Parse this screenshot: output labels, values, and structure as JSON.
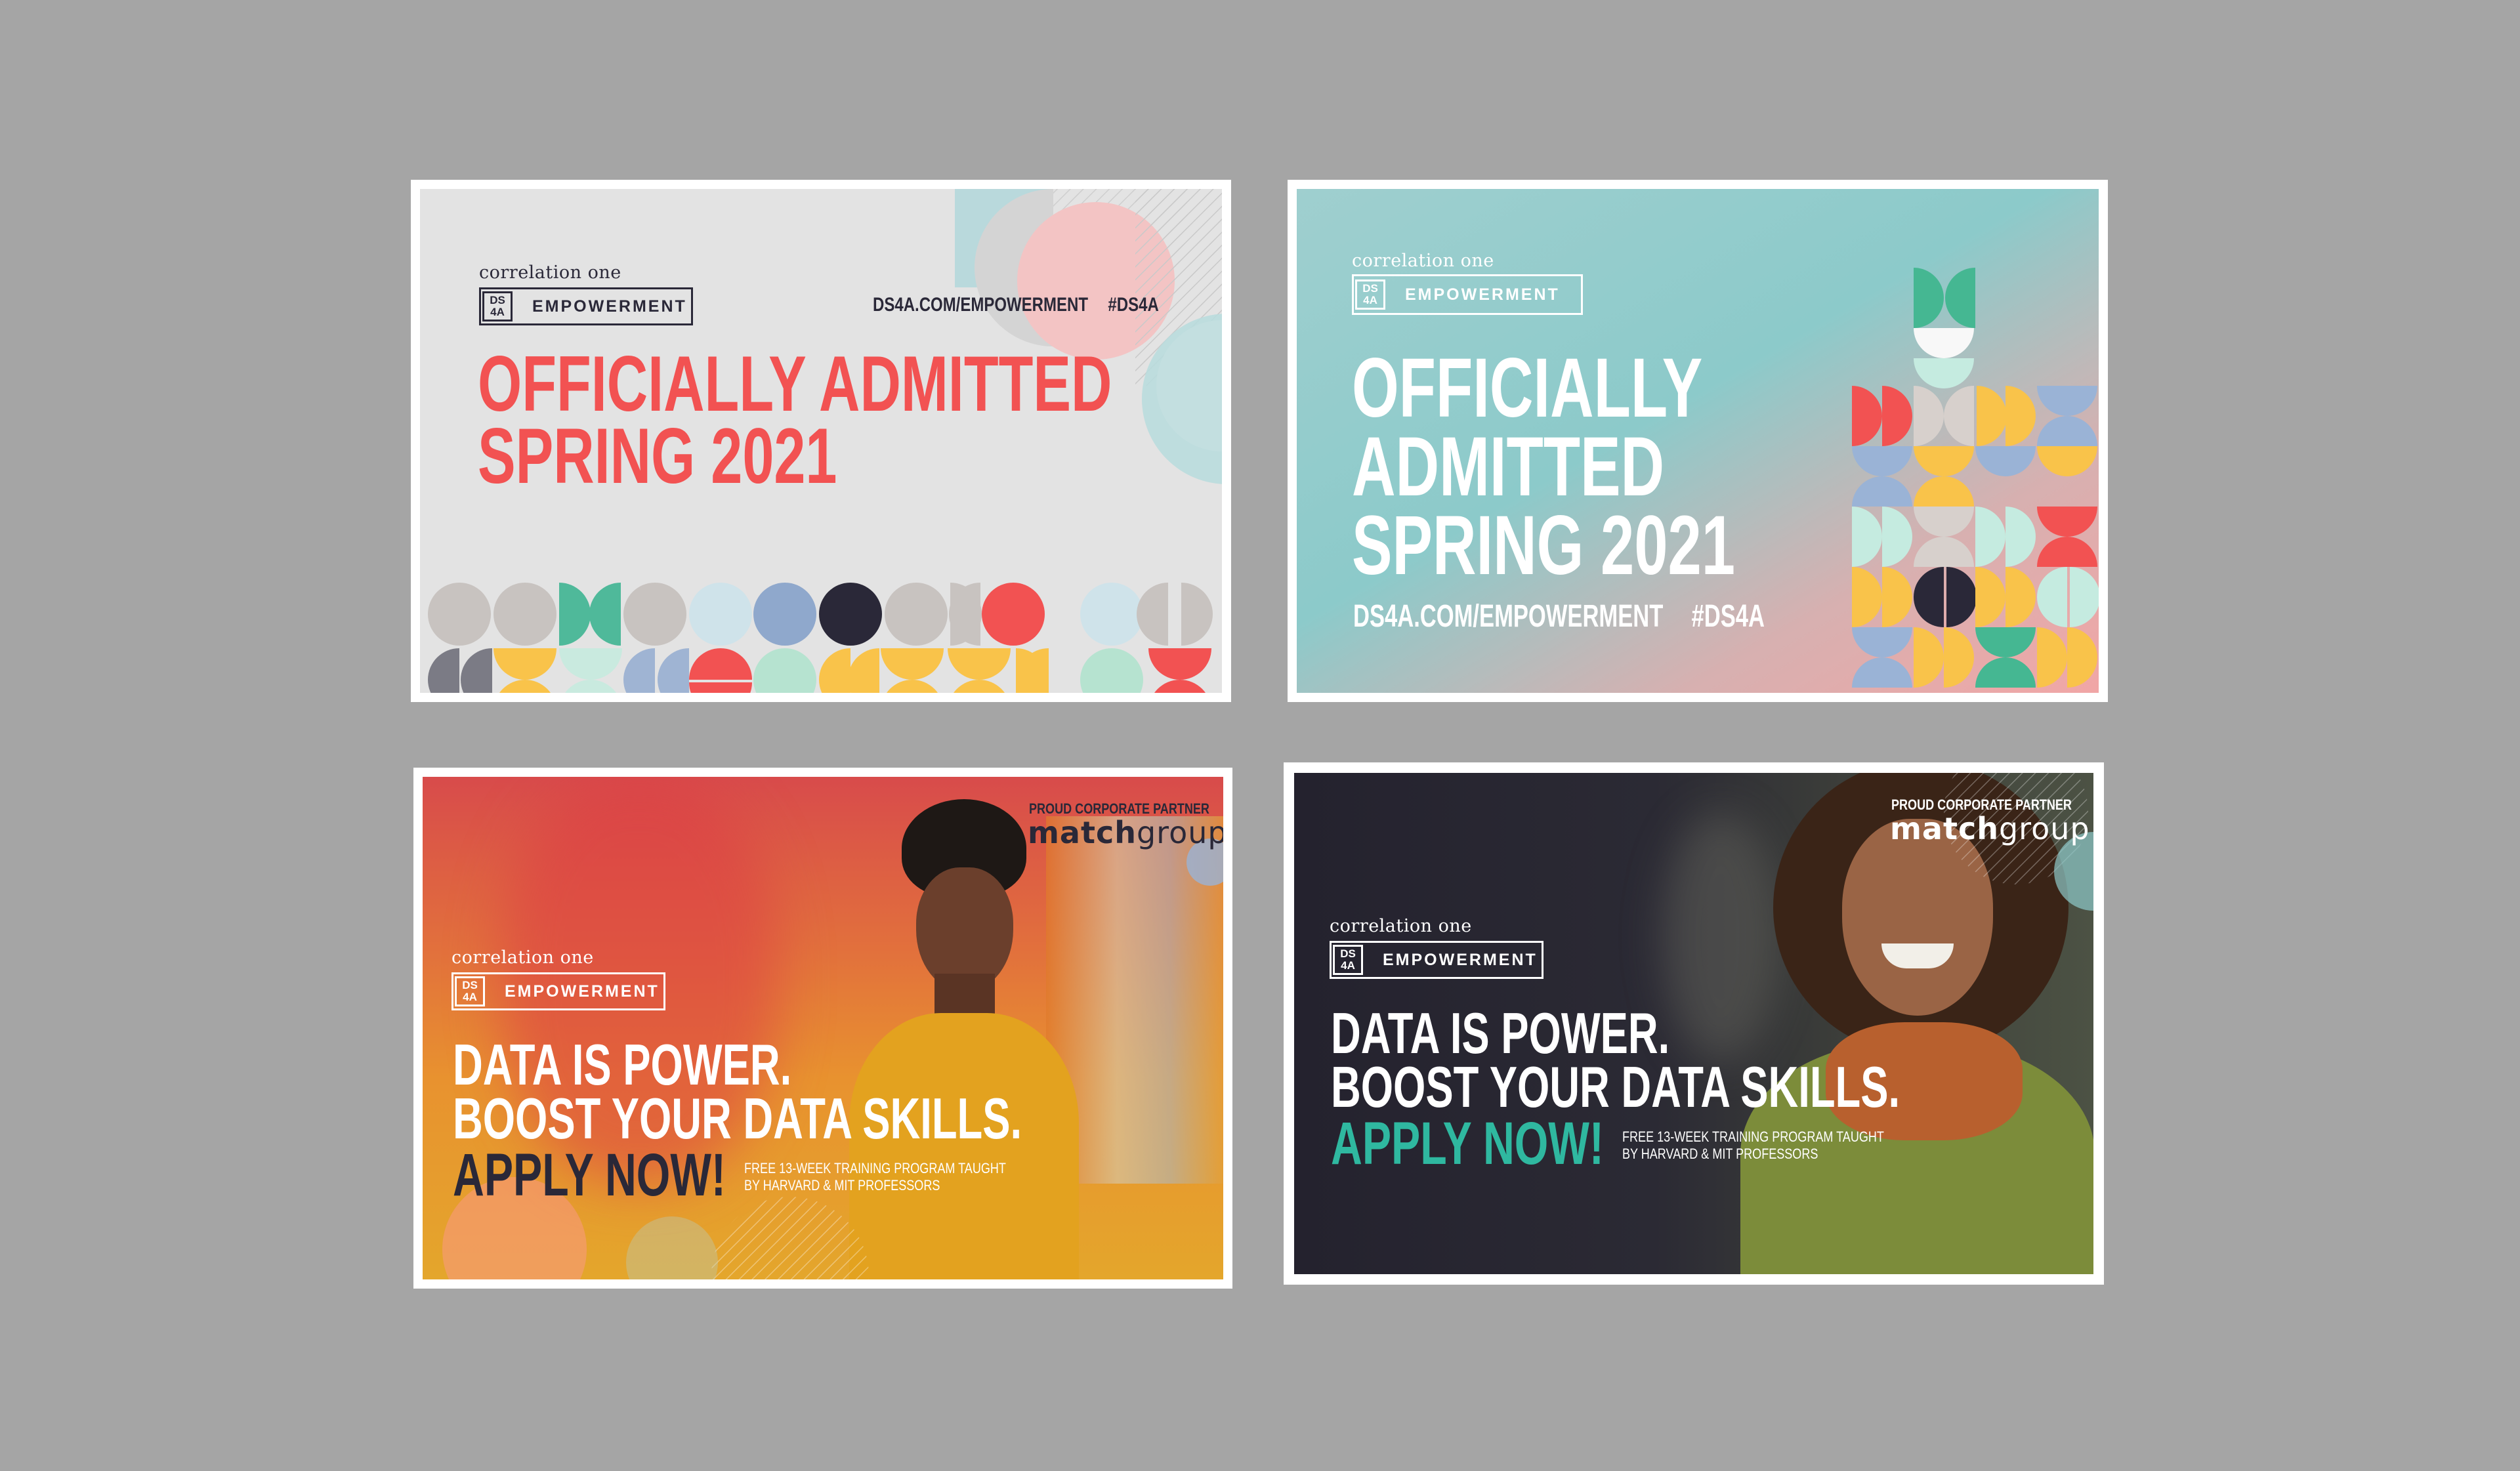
{
  "colors": {
    "coral": "#f25252",
    "teal": "#8ecbcb",
    "white": "#ffffff",
    "dark": "#2a2838",
    "green_accent": "#2fb8a0",
    "grey_bg": "#e3e3e3"
  },
  "cards": [
    {
      "brand": "correlation one",
      "badge_code_top": "DS",
      "badge_code_bottom": "4A",
      "badge_label": "EMPOWERMENT",
      "url": "DS4A.COM/EMPOWERMENT",
      "hashtag": "#DS4A",
      "headline_1": "OFFICIALLY ADMITTED",
      "headline_2": "SPRING 2021"
    },
    {
      "brand": "correlation one",
      "badge_code_top": "DS",
      "badge_code_bottom": "4A",
      "badge_label": "EMPOWERMENT",
      "headline_1": "OFFICIALLY",
      "headline_2": "ADMITTED",
      "headline_3": "SPRING 2021",
      "url": "DS4A.COM/EMPOWERMENT",
      "hashtag": "#DS4A"
    },
    {
      "partner_label": "PROUD CORPORATE PARTNER",
      "partner_name_a": "match",
      "partner_name_b": "group",
      "brand": "correlation one",
      "badge_code_top": "DS",
      "badge_code_bottom": "4A",
      "badge_label": "EMPOWERMENT",
      "headline_1": "DATA IS POWER.",
      "headline_2": "BOOST YOUR DATA SKILLS.",
      "cta": "APPLY NOW!",
      "note_1": "FREE 13-WEEK TRAINING PROGRAM TAUGHT",
      "note_2": "BY HARVARD & MIT PROFESSORS"
    },
    {
      "partner_label": "PROUD CORPORATE PARTNER",
      "partner_name_a": "match",
      "partner_name_b": "group",
      "brand": "correlation one",
      "badge_code_top": "DS",
      "badge_code_bottom": "4A",
      "badge_label": "EMPOWERMENT",
      "headline_1": "DATA IS POWER.",
      "headline_2": "BOOST YOUR DATA SKILLS.",
      "cta": "APPLY NOW!",
      "note_1": "FREE 13-WEEK TRAINING PROGRAM TAUGHT",
      "note_2": "BY HARVARD & MIT PROFESSORS"
    }
  ]
}
